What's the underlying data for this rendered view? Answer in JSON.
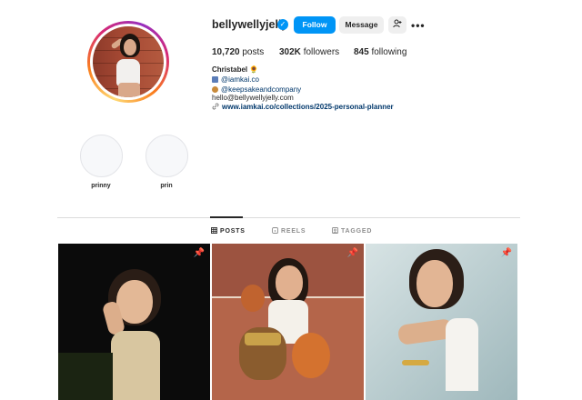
{
  "profile": {
    "username": "bellywellyjelly",
    "verified_icon": "verified-badge-icon",
    "buttons": {
      "follow": "Follow",
      "message": "Message",
      "suggest_icon": "person-add-icon",
      "more_icon": "more-options-icon"
    },
    "stats": {
      "posts_value": "10,720",
      "posts_label": "posts",
      "followers_value": "302K",
      "followers_label": "followers",
      "following_value": "845",
      "following_label": "following"
    },
    "bio": {
      "name": "Christabel 🌻",
      "line1_link": "@iamkai.co",
      "line2_link": "@keepsakeandcompany",
      "email": "hello@bellywellyjelly.com",
      "url": "www.iamkai.co/collections/2025-personal-planner"
    }
  },
  "highlights": [
    {
      "label": "prinny"
    },
    {
      "label": "prin"
    }
  ],
  "tabs": [
    {
      "label": "POSTS",
      "icon": "grid-icon",
      "active": true
    },
    {
      "label": "REELS",
      "icon": "reels-icon",
      "active": false
    },
    {
      "label": "TAGGED",
      "icon": "tagged-icon",
      "active": false
    }
  ],
  "posts": [
    {
      "pinned": true,
      "icon": "pin-icon"
    },
    {
      "pinned": true,
      "icon": "pin-icon"
    },
    {
      "pinned": true,
      "icon": "pin-icon"
    }
  ],
  "colors": {
    "accent": "#0095f6",
    "text": "#262626",
    "muted": "#8e8e8e",
    "link": "#00376b",
    "button_bg": "#efefef"
  }
}
